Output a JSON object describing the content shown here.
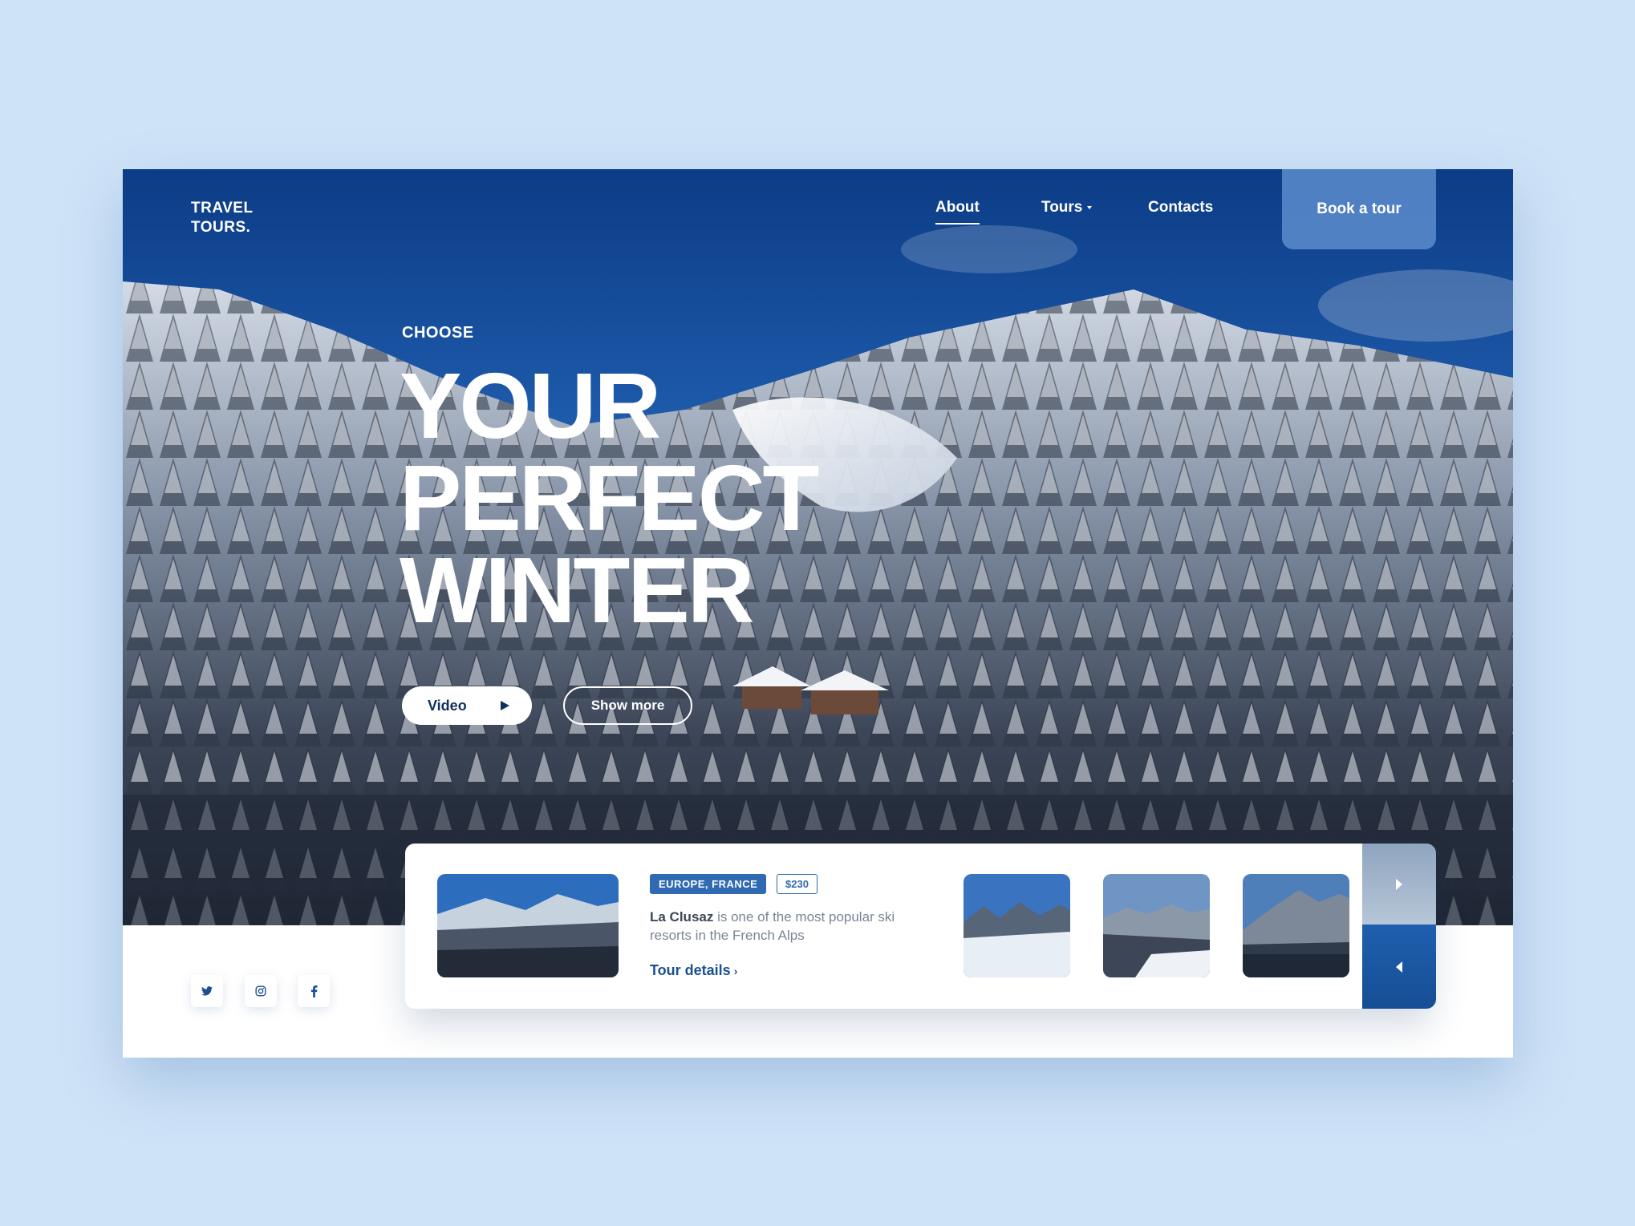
{
  "brand": {
    "line1": "TRAVEL",
    "line2": "TOURS."
  },
  "nav": {
    "about": "About",
    "tours": "Tours",
    "contacts": "Contacts",
    "book": "Book a tour"
  },
  "hero": {
    "kicker": "CHOOSE",
    "headline": [
      "YOUR",
      "PERFECT",
      "WINTER"
    ],
    "video_label": "Video",
    "more_label": "Show more"
  },
  "tour": {
    "region": "EUROPE, FRANCE",
    "price": "$230",
    "name": "La Clusaz",
    "description": " is one of the most popular ski resorts in the French Alps",
    "link": "Tour details"
  },
  "icons": {
    "twitter": "twitter-icon",
    "instagram": "instagram-icon",
    "facebook": "facebook-icon",
    "play": "play-icon",
    "next": "chevron-right-icon",
    "prev": "chevron-left-icon"
  },
  "colors": {
    "page_background": "#cfe3f7",
    "accent": "#2f6ab2",
    "link": "#1c4f92",
    "sky": "#1f5bb0"
  }
}
